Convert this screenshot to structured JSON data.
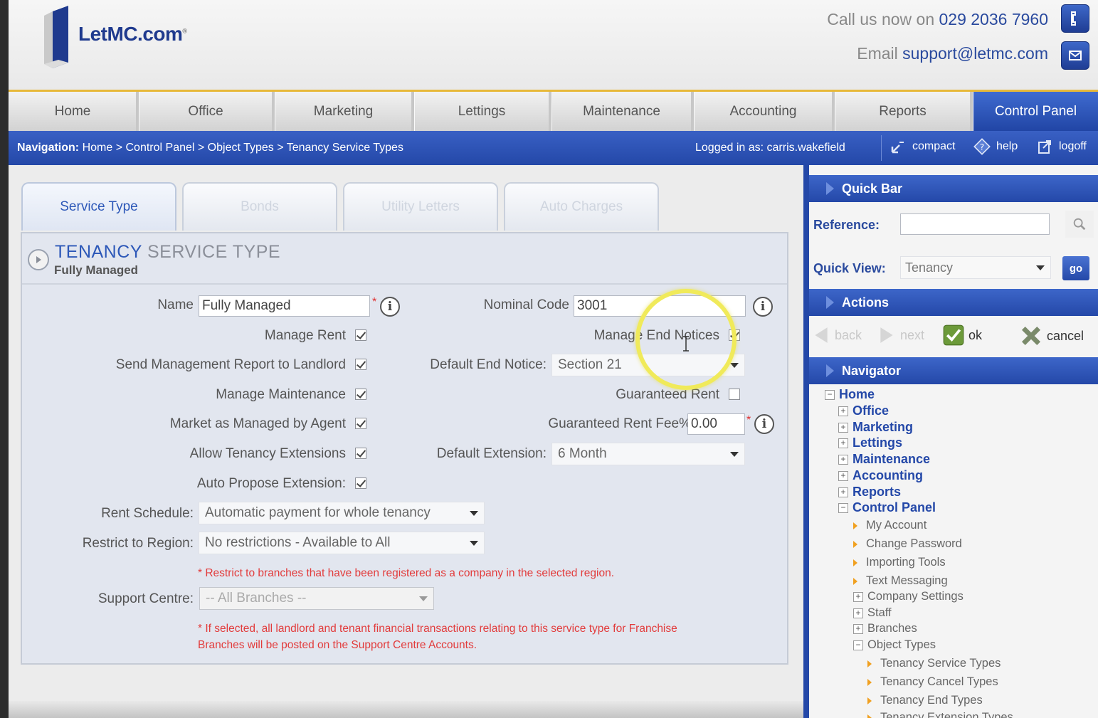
{
  "header": {
    "logo_text": "LetMC.com",
    "logo_reg": "®",
    "phone_label": "Call us now on",
    "phone_number": "029 2036 7960",
    "email_label": "Email",
    "email_address": "support@letmc.com"
  },
  "main_nav": {
    "items": [
      "Home",
      "Office",
      "Marketing",
      "Lettings",
      "Maintenance",
      "Accounting",
      "Reports",
      "Control Panel"
    ],
    "active": "Control Panel"
  },
  "breadcrumb": {
    "label": "Navigation:",
    "path": "Home > Control Panel > Object Types > Tenancy Service Types",
    "logged_in": "Logged in as: carris.wakefield",
    "compact": "compact",
    "help": "help",
    "logoff": "logoff"
  },
  "tabs": {
    "items": [
      "Service Type",
      "Bonds",
      "Utility Letters",
      "Auto Charges"
    ],
    "active": "Service Type"
  },
  "form": {
    "title_part1": "TENANCY",
    "title_part2": "SERVICE TYPE",
    "subtitle": "Fully Managed",
    "name_label": "Name",
    "name_value": "Fully Managed",
    "nominal_code_label": "Nominal Code",
    "nominal_code_value": "3001",
    "manage_rent_label": "Manage Rent",
    "manage_rent_checked": true,
    "manage_end_notices_label": "Manage End Notices",
    "manage_end_notices_checked": true,
    "send_report_label": "Send Management Report to Landlord",
    "send_report_checked": true,
    "default_end_notice_label": "Default End Notice:",
    "default_end_notice_value": "Section 21",
    "manage_maintenance_label": "Manage Maintenance",
    "manage_maintenance_checked": true,
    "guaranteed_rent_label": "Guaranteed Rent",
    "guaranteed_rent_checked": false,
    "market_managed_label": "Market as Managed by Agent",
    "market_managed_checked": true,
    "guaranteed_rent_fee_label": "Guaranteed Rent Fee%",
    "guaranteed_rent_fee_value": "0.00",
    "allow_extensions_label": "Allow Tenancy Extensions",
    "allow_extensions_checked": true,
    "default_extension_label": "Default Extension:",
    "default_extension_value": "6 Month",
    "auto_propose_label": "Auto Propose Extension:",
    "auto_propose_checked": true,
    "rent_schedule_label": "Rent Schedule:",
    "rent_schedule_value": "Automatic payment for whole tenancy",
    "restrict_region_label": "Restrict to Region:",
    "restrict_region_value": "No restrictions - Available to All",
    "restrict_note": "* Restrict to branches that have been registered as a company in the selected region.",
    "support_centre_label": "Support Centre:",
    "support_centre_value": "-- All Branches --",
    "support_note_line1": "* If selected, all landlord and tenant financial transactions relating to this service type for Franchise",
    "support_note_line2": "Branches will be posted on the Support Centre Accounts."
  },
  "quick_bar": {
    "title": "Quick Bar",
    "reference_label": "Reference:",
    "reference_value": "",
    "quick_view_label": "Quick View:",
    "quick_view_value": "Tenancy",
    "go_label": "go"
  },
  "actions": {
    "title": "Actions",
    "back": "back",
    "next": "next",
    "ok": "ok",
    "cancel": "cancel"
  },
  "navigator": {
    "title": "Navigator",
    "root": "Home",
    "sections": [
      "Office",
      "Marketing",
      "Lettings",
      "Maintenance",
      "Accounting",
      "Reports"
    ],
    "control_panel": "Control Panel",
    "cp_links": [
      "My Account",
      "Change Password",
      "Importing Tools",
      "Text Messaging"
    ],
    "cp_folders": [
      "Company Settings",
      "Staff",
      "Branches"
    ],
    "object_types": "Object Types",
    "ot_links": [
      "Tenancy Service Types",
      "Tenancy Cancel Types",
      "Tenancy End Types",
      "Tenancy Extension Types"
    ]
  },
  "colors": {
    "brand_blue": "#2448a8",
    "accent_gold": "#e7b93a",
    "required_red": "#e03030",
    "highlight_yellow": "#f0ea5a"
  }
}
